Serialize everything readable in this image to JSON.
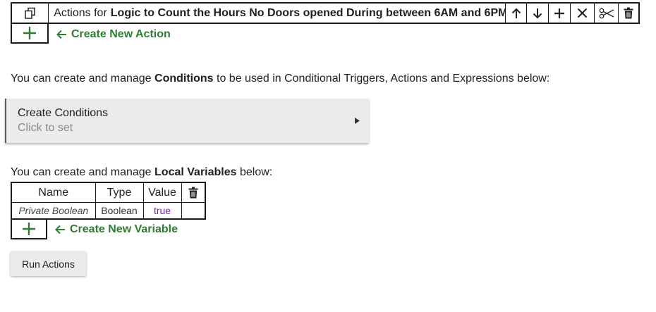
{
  "actions": {
    "prefix": "Actions for",
    "rule_name": "Logic to Count the Hours No Doors opened During between 6AM and 6PM",
    "toolbar": [
      "copy-icon",
      "arrow-up-icon",
      "arrow-down-icon",
      "plus-icon",
      "close-icon",
      "scissors-icon",
      "trash-icon"
    ],
    "create_label": "Create New Action"
  },
  "conditions": {
    "intro_before": "You can create and manage",
    "intro_bold": "Conditions",
    "intro_after": "to be used in Conditional Triggers, Actions and Expressions below:",
    "card_title": "Create Conditions",
    "card_subtitle": "Click to set"
  },
  "variables": {
    "intro_before": "You can create and manage",
    "intro_bold": "Local Variables",
    "intro_after": "below:",
    "headers": [
      "Name",
      "Type",
      "Value"
    ],
    "rows": [
      {
        "name": "Private Boolean",
        "type": "Boolean",
        "value": "true"
      }
    ],
    "create_label": "Create New Variable"
  },
  "run_button": "Run Actions",
  "colors": {
    "green": "#2e7d32",
    "value_purple": "#7b1fa2",
    "card_bg": "#ebebeb"
  }
}
